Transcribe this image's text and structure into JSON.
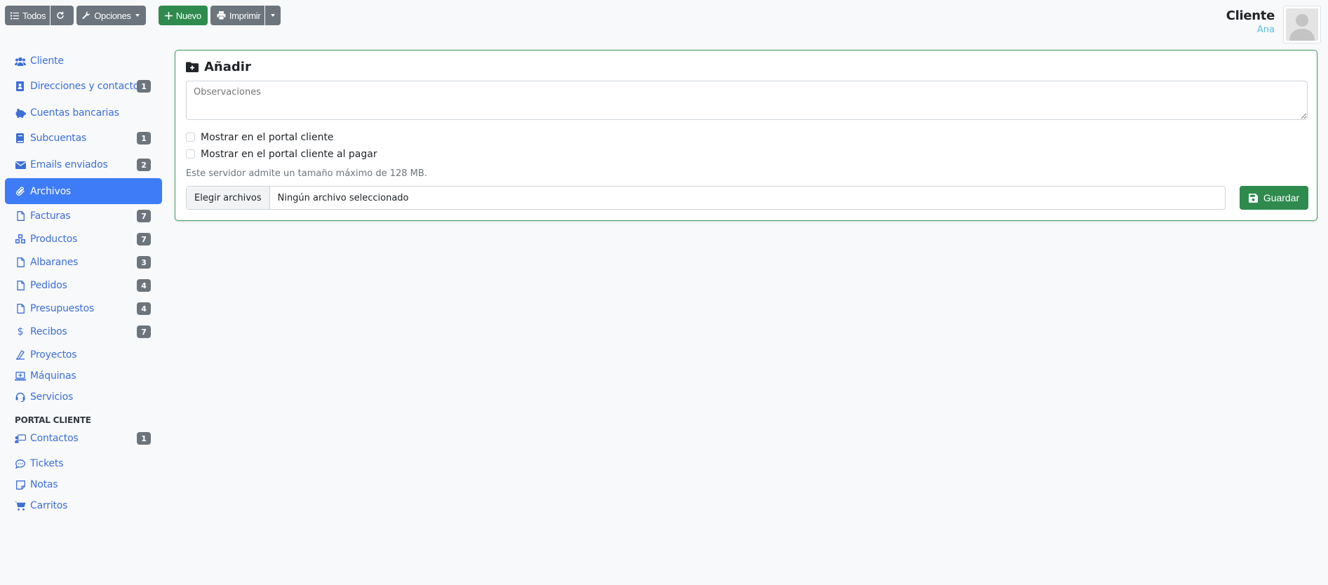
{
  "toolbar": {
    "todos_label": "Todos",
    "opciones_label": "Opciones",
    "nuevo_label": "Nuevo",
    "imprimir_label": "Imprimir"
  },
  "header": {
    "title": "Cliente",
    "subtitle": "Ana"
  },
  "sidebar": {
    "items": [
      {
        "label": "Cliente",
        "icon": "users-icon",
        "badge": ""
      },
      {
        "label": "Direcciones y contactos",
        "icon": "address-book-icon",
        "badge": "1"
      },
      {
        "label": "Cuentas bancarias",
        "icon": "piggy-bank-icon",
        "badge": ""
      },
      {
        "label": "Subcuentas",
        "icon": "book-icon",
        "badge": "1"
      },
      {
        "label": "Emails enviados",
        "icon": "envelope-icon",
        "badge": "2"
      },
      {
        "label": "Archivos",
        "icon": "paperclip-icon",
        "badge": "",
        "active": true
      },
      {
        "label": "Facturas",
        "icon": "file-icon",
        "badge": "7"
      },
      {
        "label": "Productos",
        "icon": "cubes-icon",
        "badge": "7"
      },
      {
        "label": "Albaranes",
        "icon": "file-icon",
        "badge": "3"
      },
      {
        "label": "Pedidos",
        "icon": "file-icon",
        "badge": "4"
      },
      {
        "label": "Presupuestos",
        "icon": "file-icon",
        "badge": "4"
      },
      {
        "label": "Recibos",
        "icon": "dollar-icon",
        "badge": "7"
      },
      {
        "label": "Proyectos",
        "icon": "drafting-icon",
        "badge": ""
      },
      {
        "label": "Máquinas",
        "icon": "laptop-medical-icon",
        "badge": ""
      },
      {
        "label": "Servicios",
        "icon": "headset-icon",
        "badge": ""
      }
    ],
    "section_title": "PORTAL CLIENTE",
    "portal_items": [
      {
        "label": "Contactos",
        "icon": "chalkboard-user-icon",
        "badge": "1"
      },
      {
        "label": "Tickets",
        "icon": "comment-dots-icon",
        "badge": ""
      },
      {
        "label": "Notas",
        "icon": "sticky-note-icon",
        "badge": ""
      },
      {
        "label": "Carritos",
        "icon": "shopping-cart-icon",
        "badge": ""
      }
    ]
  },
  "card": {
    "title": "Añadir",
    "observaciones_placeholder": "Observaciones",
    "check1_label": "Mostrar en el portal cliente",
    "check2_label": "Mostrar en el portal cliente al pagar",
    "help_text": "Este servidor admite un tamaño máximo de 128 MB.",
    "file_button_label": "Elegir archivos",
    "file_name_text": "Ningún archivo seleccionado",
    "save_label": "Guardar"
  },
  "colors": {
    "primary": "#3d7bf7",
    "link": "#3b6fd8",
    "success": "#2e8b4d",
    "secondary": "#6c757d",
    "info": "#5bc0de"
  }
}
